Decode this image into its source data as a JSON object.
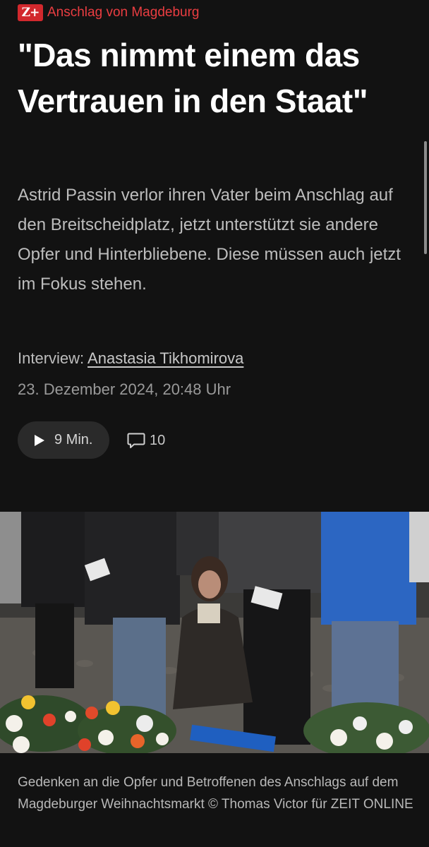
{
  "kicker": {
    "badge": "Z+",
    "label": "Anschlag von Magdeburg"
  },
  "headline": "\"Das nimmt einem das Vertrauen in den Staat\"",
  "lead": "Astrid Passin verlor ihren Vater beim Anschlag auf den Breitscheidplatz, jetzt unterstützt sie andere Opfer und Hinterbliebene. Diese müssen auch jetzt im Fokus stehen.",
  "byline": {
    "prefix": "Interview: ",
    "author": "Anastasia Tikhomirova"
  },
  "date": "23. Dezember 2024, 20:48 Uhr",
  "audio": {
    "label": "9 Min.",
    "icon": "play-icon"
  },
  "comments": {
    "count": "10",
    "icon": "comment-icon"
  },
  "photo": {
    "caption": "Gedenken an die Opfer und Betroffenen des Anschlags auf dem Magdeburger Weihnachtsmarkt © Thomas Victor für ZEIT ONLINE"
  },
  "colors": {
    "background": "#121212",
    "accent": "#d2282d",
    "kicker_text": "#ea3d41",
    "lead_text": "#bdbdbd",
    "pill_bg": "#2a2a2a"
  }
}
